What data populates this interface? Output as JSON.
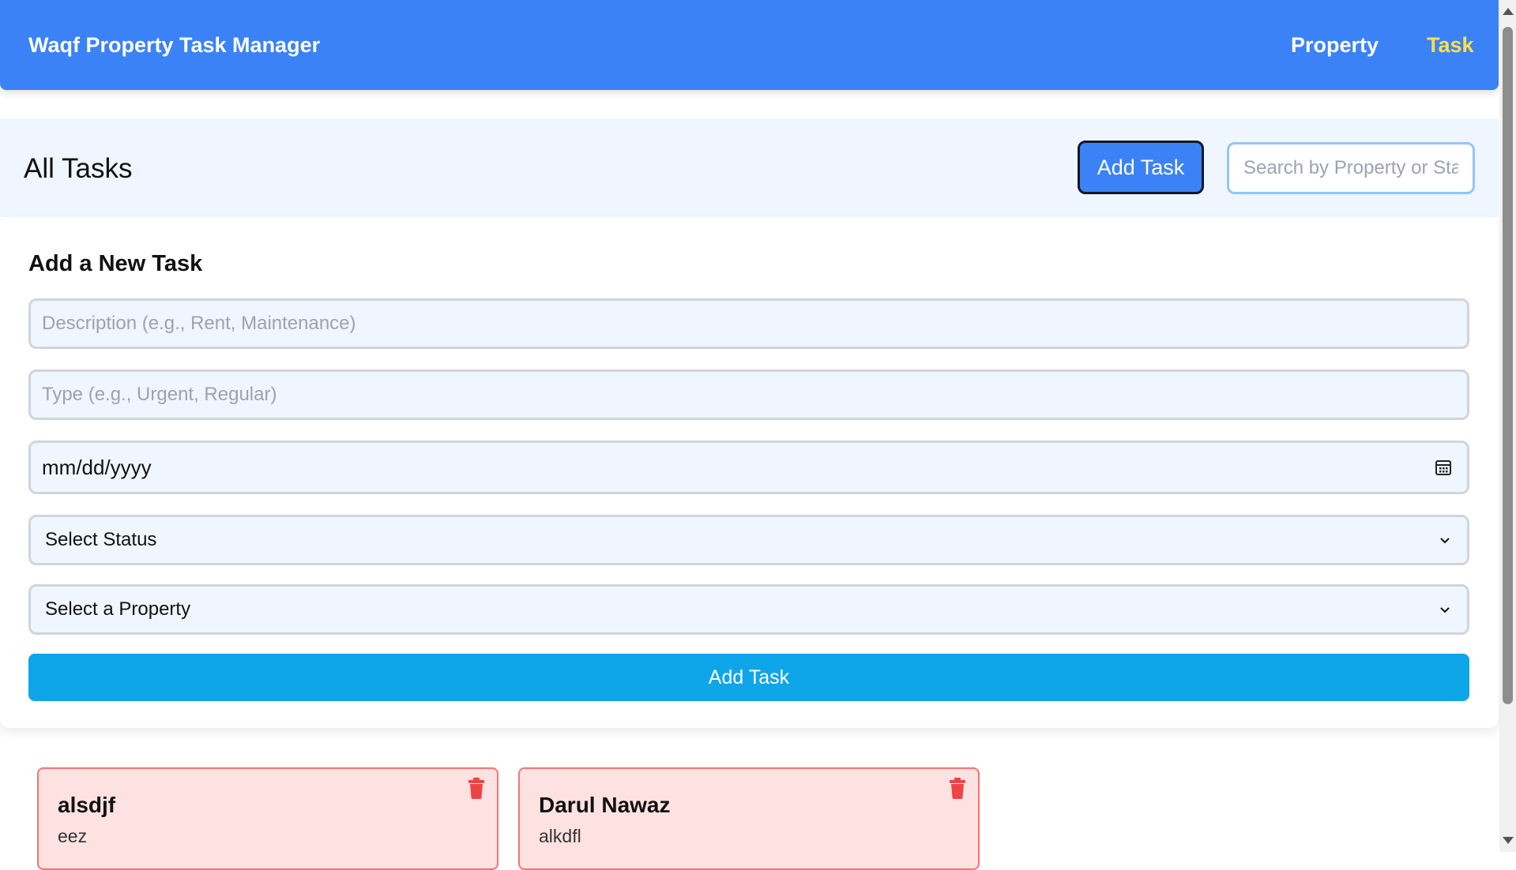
{
  "navbar": {
    "brand": "Waqf Property Task Manager",
    "links": [
      {
        "label": "Property",
        "active": false
      },
      {
        "label": "Task",
        "active": true
      }
    ],
    "background_color": "#3b82f6",
    "active_link_color": "#fde047"
  },
  "header": {
    "title": "All Tasks",
    "add_task_label": "Add Task",
    "search_placeholder": "Search by Property or Status"
  },
  "form": {
    "title": "Add a New Task",
    "description_placeholder": "Description (e.g., Rent, Maintenance)",
    "type_placeholder": "Type (e.g., Urgent, Regular)",
    "date_value": "mm/dd/yyyy",
    "status_select": "Select Status",
    "property_select": "Select a Property",
    "submit_label": "Add Task",
    "submit_color": "#0ea5e9"
  },
  "tasks": [
    {
      "name": "alsdjf",
      "detail": "eez",
      "icon": "trash-icon"
    },
    {
      "name": "Darul Nawaz",
      "detail": "alkdfl",
      "icon": "trash-icon"
    }
  ],
  "colors": {
    "task_card_bg": "#fee2e2",
    "task_card_border": "#f87171",
    "delete_icon": "#ef4444"
  }
}
